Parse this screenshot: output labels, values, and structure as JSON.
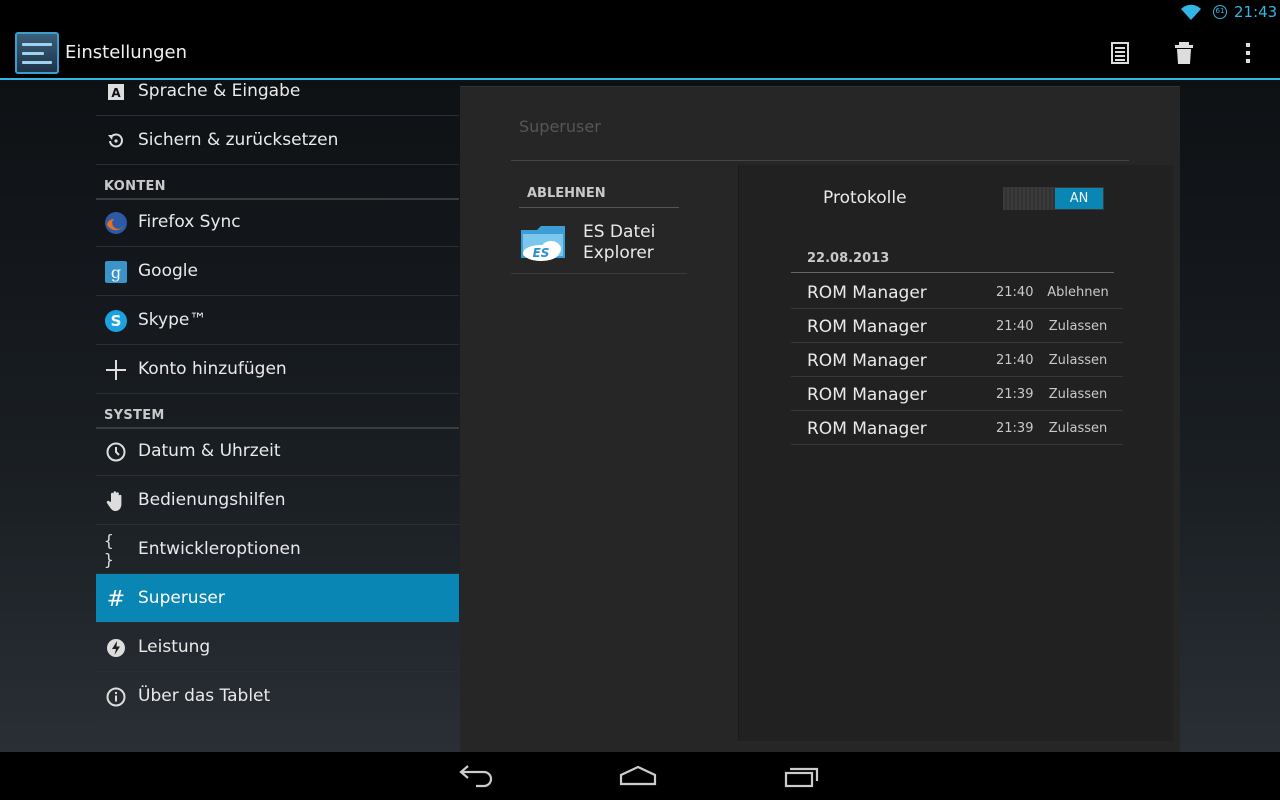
{
  "status": {
    "time": "21:43",
    "battery": "61"
  },
  "actionbar": {
    "title": "Einstellungen",
    "actions": [
      "list-icon",
      "trash-icon",
      "overflow-menu-icon"
    ]
  },
  "settings": {
    "item_language": "Sprache & Eingabe",
    "item_backup": "Sichern & zurücksetzen",
    "header_accounts": "KONTEN",
    "item_firefox": "Firefox Sync",
    "item_google": "Google",
    "item_skype": "Skype™",
    "item_add_account": "Konto hinzufügen",
    "header_system": "SYSTEM",
    "item_datetime": "Datum & Uhrzeit",
    "item_accessibility": "Bedienungshilfen",
    "item_developer": "Entwickleroptionen",
    "item_superuser": "Superuser",
    "item_performance": "Leistung",
    "item_about": "Über das Tablet"
  },
  "superuser": {
    "title": "Superuser",
    "deny_header": "ABLEHNEN",
    "deny_app_line1": "ES Datei",
    "deny_app_line2": "Explorer",
    "log_label": "Protokolle",
    "toggle_state": "AN",
    "log_date": "22.08.2013",
    "log": [
      {
        "app": "ROM Manager",
        "time": "21:40",
        "result": "Ablehnen"
      },
      {
        "app": "ROM Manager",
        "time": "21:40",
        "result": "Zulassen"
      },
      {
        "app": "ROM Manager",
        "time": "21:40",
        "result": "Zulassen"
      },
      {
        "app": "ROM Manager",
        "time": "21:39",
        "result": "Zulassen"
      },
      {
        "app": "ROM Manager",
        "time": "21:39",
        "result": "Zulassen"
      }
    ]
  },
  "colors": {
    "accent": "#33b5e5",
    "selected": "#0a86b5"
  }
}
